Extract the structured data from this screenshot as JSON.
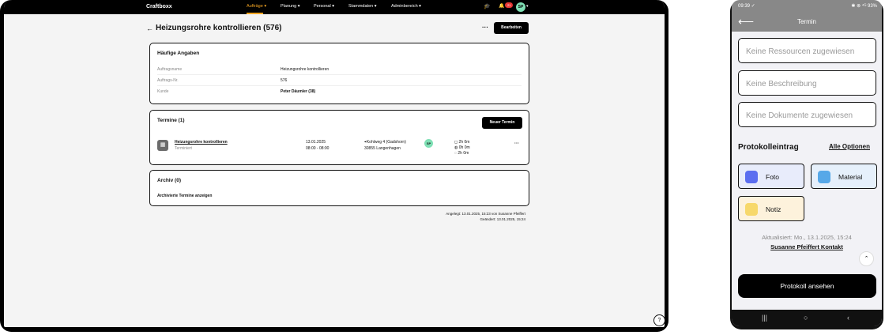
{
  "tablet": {
    "topnav": {
      "brand": "Craftboxx",
      "items": [
        {
          "label": "Aufträge ▾"
        },
        {
          "label": "Planung ▾"
        },
        {
          "label": "Personal ▾"
        },
        {
          "label": "Stammdaten ▾"
        },
        {
          "label": "Adminbereich ▾"
        }
      ],
      "notification_count": "21",
      "avatar_initials": "SP"
    },
    "page": {
      "title": "Heizungsrohre kontrollieren (576)",
      "more_label": "···",
      "edit_label": "Bearbeiten"
    },
    "general": {
      "title": "Häufige Angaben",
      "rows": [
        {
          "label": "Auftragsname",
          "value": "Heizungsrohre kontrollieren"
        },
        {
          "label": "Auftrags-Nr.",
          "value": "576"
        },
        {
          "label": "Kunde",
          "value": "Peter Däumler (38)"
        }
      ]
    },
    "termine": {
      "title": "Termine (1)",
      "new_label": "Neuer Termin",
      "appointment": {
        "title": "Heizungsrohre kontrollieren",
        "status": "Terminiert",
        "date": "13.01.2025",
        "time": "08:00 - 08:00",
        "address_line1": "Kohlweg 4 (Gadshorn)",
        "address_line2": "30855 Langenhagen",
        "assignee_initials": "SP",
        "durations": [
          "2h 0m",
          "0h 0m",
          "2h 0m"
        ],
        "more_label": "···"
      }
    },
    "archiv": {
      "title": "Archiv (0)",
      "link_label": "Archivierte Termine anzeigen"
    },
    "meta": {
      "created": "Angelegt: 13.01.2025, 15:23 von Susanne Pfeiffert",
      "changed": "Geändert: 13.01.2025, 15:24"
    },
    "help_label": "?"
  },
  "phone": {
    "status": {
      "time": "09:39 ✓",
      "right": "✱ ⊗ ⁴ᴳ 93%"
    },
    "header_title": "Termin",
    "fields": [
      {
        "label": "Keine Ressourcen zugewiesen"
      },
      {
        "label": "Keine Beschreibung"
      },
      {
        "label": "Keine Dokumente zugewiesen"
      }
    ],
    "protocol": {
      "title": "Protokolleintrag",
      "all_options": "Alle Optionen",
      "tiles": {
        "foto": "Foto",
        "material": "Material",
        "notiz": "Notiz"
      }
    },
    "updated": "Aktualisiert: Mo., 13.1.2025, 15:24",
    "contact": "Susanne Pfeiffert Kontakt",
    "primary_label": "Protokoll ansehen",
    "colors": {
      "foto_bg": "#e8ecfb",
      "material_bg": "#e6f0fb",
      "notiz_bg": "#fdf2dc",
      "nav_active": "#f5a623",
      "avatar": "#7fe0b5"
    }
  }
}
